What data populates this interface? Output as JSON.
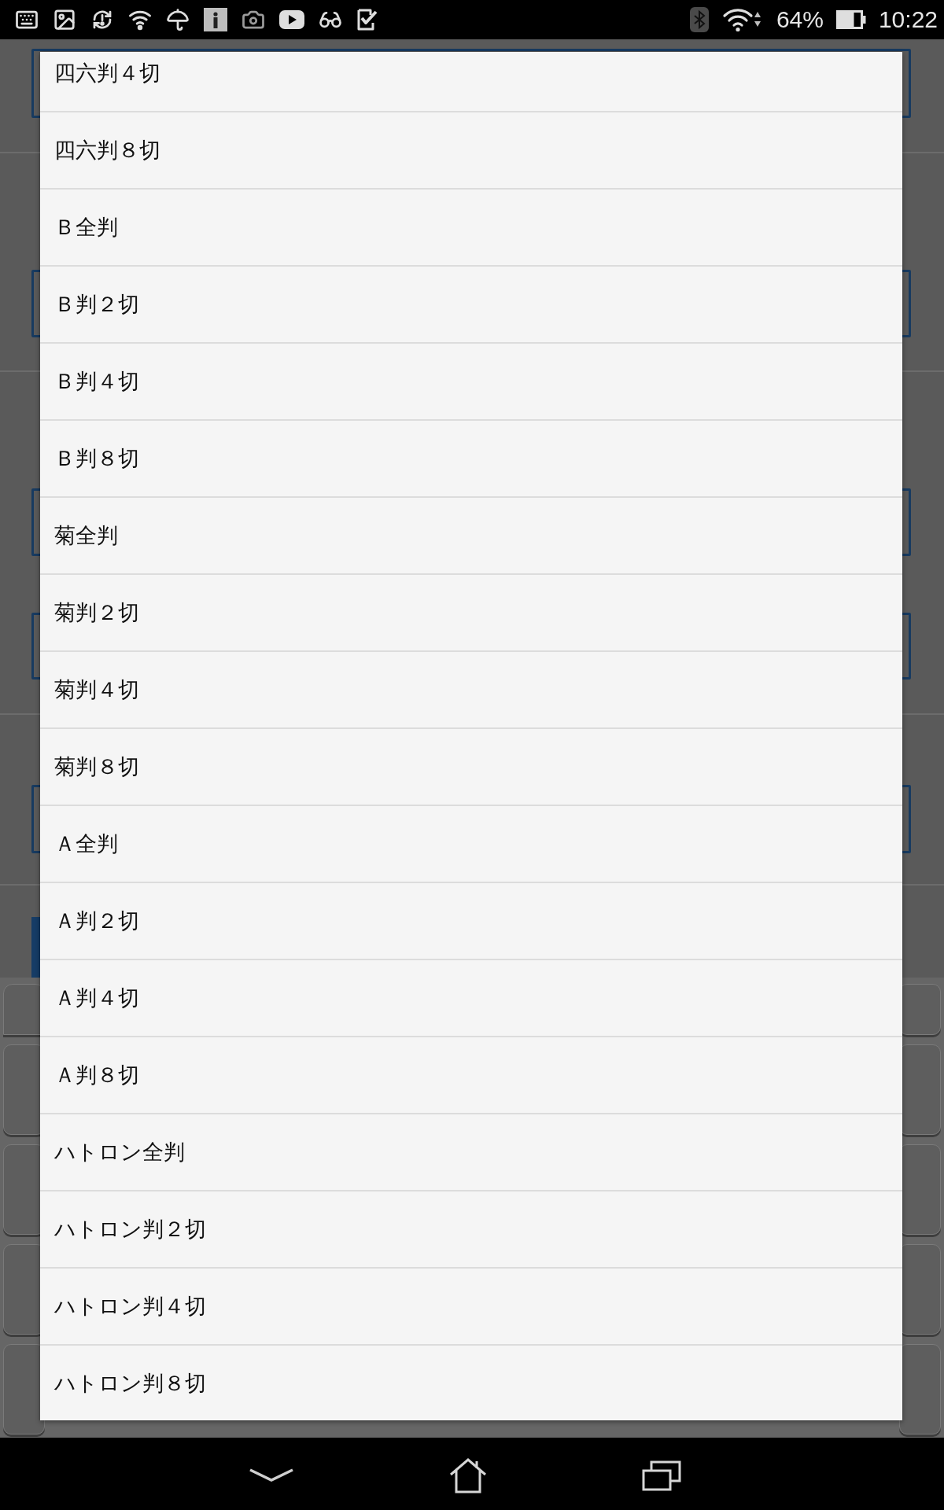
{
  "status_bar": {
    "battery_percent": "64%",
    "time": "10:22"
  },
  "size_list": {
    "items": [
      "四六判４切",
      "四六判８切",
      "Ｂ全判",
      "Ｂ判２切",
      "Ｂ判４切",
      "Ｂ判８切",
      "菊全判",
      "菊判２切",
      "菊判４切",
      "菊判８切",
      "Ａ全判",
      "Ａ判２切",
      "Ａ判４切",
      "Ａ判８切",
      "ハトロン全判",
      "ハトロン判２切",
      "ハトロン判４切",
      "ハトロン判８切"
    ]
  }
}
